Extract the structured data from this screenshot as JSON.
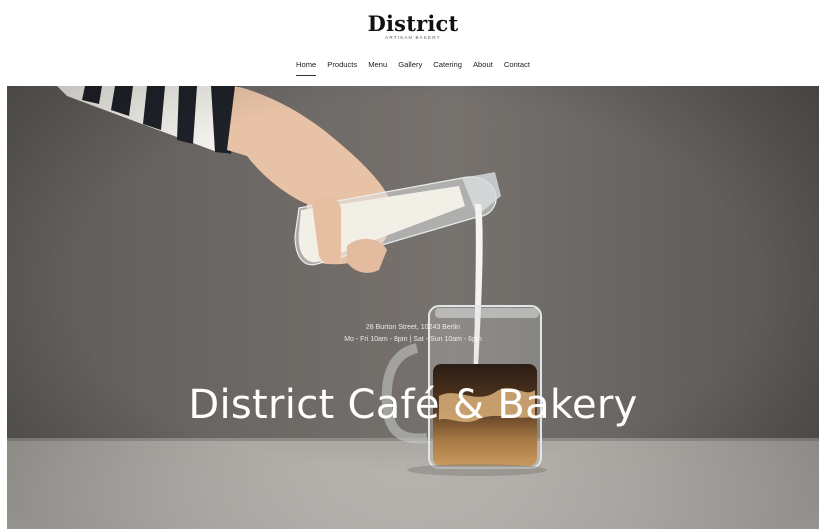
{
  "brand": {
    "name": "District",
    "tagline": "ARTISAN BAKERY"
  },
  "nav": {
    "items": [
      {
        "label": "Home",
        "active": true
      },
      {
        "label": "Products",
        "active": false
      },
      {
        "label": "Menu",
        "active": false
      },
      {
        "label": "Gallery",
        "active": false
      },
      {
        "label": "Catering",
        "active": false
      },
      {
        "label": "About",
        "active": false
      },
      {
        "label": "Contact",
        "active": false
      }
    ]
  },
  "hero": {
    "title": "District Café & Bakery",
    "address": "28 Burton Street, 10243 Berlin",
    "hours": "Mo - Fri 10am - 8pm | Sat - Sun 10am - 6pm"
  },
  "colors": {
    "wall": "#6f6a66",
    "table": "#b9b6b1",
    "accent": "#ffffff"
  }
}
